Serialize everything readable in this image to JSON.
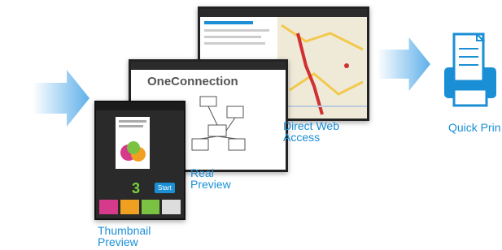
{
  "labels": {
    "thumbnail": "Thumbnail\nPreview",
    "real": "Real\nPreview",
    "direct_web": "Direct Web\nAccess",
    "quick_print": "Quick Prin"
  },
  "screens": {
    "real_preview_title": "OneConnection",
    "copies": "3",
    "start": "Start"
  },
  "icons": [
    "arrow-right-icon",
    "printer-icon"
  ],
  "colors": {
    "accent": "#1a8fd6",
    "arrow": "#5fb0ea"
  }
}
